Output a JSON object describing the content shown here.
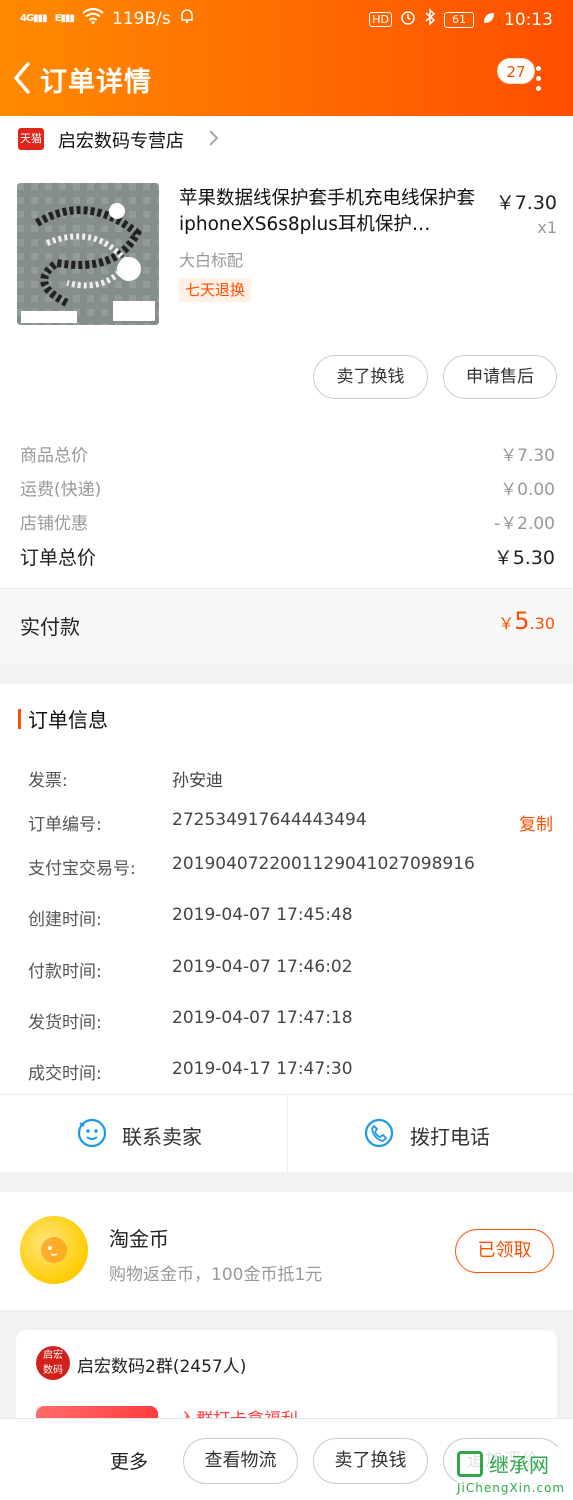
{
  "status_bar": {
    "net_speed": "119B/s",
    "battery": "61",
    "time": "10:13"
  },
  "header": {
    "title": "订单详情",
    "badge_count": "27"
  },
  "shop": {
    "platform_tag": "天猫",
    "name": "启宏数码专营店"
  },
  "item": {
    "title": "苹果数据线保护套手机充电线保护套iphoneXS6s8plus耳机保护…",
    "price": "￥7.30",
    "qty": "x1",
    "sku": "大白标配",
    "tag": "七天退换"
  },
  "item_actions": {
    "sell": "卖了换钱",
    "after_sale": "申请售后"
  },
  "summary": {
    "rows": [
      {
        "label": "商品总价",
        "value": "￥7.30"
      },
      {
        "label": "运费(快递)",
        "value": "￥0.00"
      },
      {
        "label": "店铺优惠",
        "value": "-￥2.00"
      }
    ],
    "total_label": "订单总价",
    "total_value": "￥5.30",
    "paid_label": "实付款",
    "paid_currency": "￥",
    "paid_int": "5",
    "paid_dec": ".30"
  },
  "order_info": {
    "title": "订单信息",
    "rows": [
      {
        "label": "发票:",
        "value": "孙安迪"
      },
      {
        "label": "订单编号:",
        "value": "272534917644443494"
      },
      {
        "label": "支付宝交易号:",
        "value": "2019040722001129041027098916"
      },
      {
        "label": "创建时间:",
        "value": "2019-04-07 17:45:48"
      },
      {
        "label": "付款时间:",
        "value": "2019-04-07 17:46:02"
      },
      {
        "label": "发货时间:",
        "value": "2019-04-07 17:47:18"
      },
      {
        "label": "成交时间:",
        "value": "2019-04-17 17:47:30"
      }
    ],
    "copy_label": "复制",
    "contact_seller": "联系卖家",
    "call": "拨打电话"
  },
  "coins": {
    "title": "淘金币",
    "subtitle": "购物返金币，100金币抵1元",
    "claimed": "已领取"
  },
  "group": {
    "avatar_text_1": "启宏",
    "avatar_text_2": "数码",
    "name": "启宏数码2群(2457人)",
    "promo": "入群打卡拿福利"
  },
  "bottom_bar": {
    "more": "更多",
    "logistics": "查看物流",
    "sell": "卖了换钱",
    "review": "追加评价"
  },
  "watermark": {
    "cn": "继承网",
    "en": "JiChengXin.com"
  },
  "colors": {
    "accent": "#ff5000",
    "header_start": "#ff8a00",
    "header_end": "#ff4e00"
  }
}
